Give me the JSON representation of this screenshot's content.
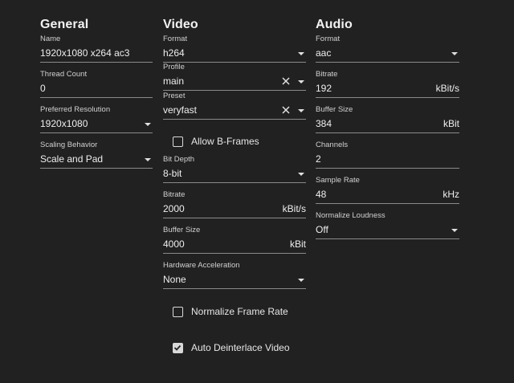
{
  "general": {
    "heading": "General",
    "name": {
      "label": "Name",
      "value": "1920x1080 x264 ac3"
    },
    "thread_count": {
      "label": "Thread Count",
      "value": "0"
    },
    "preferred_resolution": {
      "label": "Preferred Resolution",
      "value": "1920x1080"
    },
    "scaling_behavior": {
      "label": "Scaling Behavior",
      "value": "Scale and Pad"
    }
  },
  "video": {
    "heading": "Video",
    "format": {
      "label": "Format",
      "value": "h264"
    },
    "profile": {
      "label": "Profile",
      "value": "main"
    },
    "preset": {
      "label": "Preset",
      "value": "veryfast"
    },
    "allow_bframes": {
      "label": "Allow B-Frames",
      "checked": false
    },
    "bit_depth": {
      "label": "Bit Depth",
      "value": "8-bit"
    },
    "bitrate": {
      "label": "Bitrate",
      "value": "2000",
      "unit": "kBit/s"
    },
    "buffer_size": {
      "label": "Buffer Size",
      "value": "4000",
      "unit": "kBit"
    },
    "hw_accel": {
      "label": "Hardware Acceleration",
      "value": "None"
    },
    "normalize_frame_rate": {
      "label": "Normalize Frame Rate",
      "checked": false
    },
    "auto_deinterlace": {
      "label": "Auto Deinterlace Video",
      "checked": true
    }
  },
  "audio": {
    "heading": "Audio",
    "format": {
      "label": "Format",
      "value": "aac"
    },
    "bitrate": {
      "label": "Bitrate",
      "value": "192",
      "unit": "kBit/s"
    },
    "buffer_size": {
      "label": "Buffer Size",
      "value": "384",
      "unit": "kBit"
    },
    "channels": {
      "label": "Channels",
      "value": "2"
    },
    "sample_rate": {
      "label": "Sample Rate",
      "value": "48",
      "unit": "kHz"
    },
    "normalize_loudness": {
      "label": "Normalize Loudness",
      "value": "Off"
    }
  },
  "icons": {
    "dropdown": "chevron-down-icon",
    "clear": "close-icon",
    "checkbox": "checkbox-icon"
  },
  "colors": {
    "background": "#212121",
    "text": "#e6e6e6",
    "underline": "#8a8a8a"
  }
}
